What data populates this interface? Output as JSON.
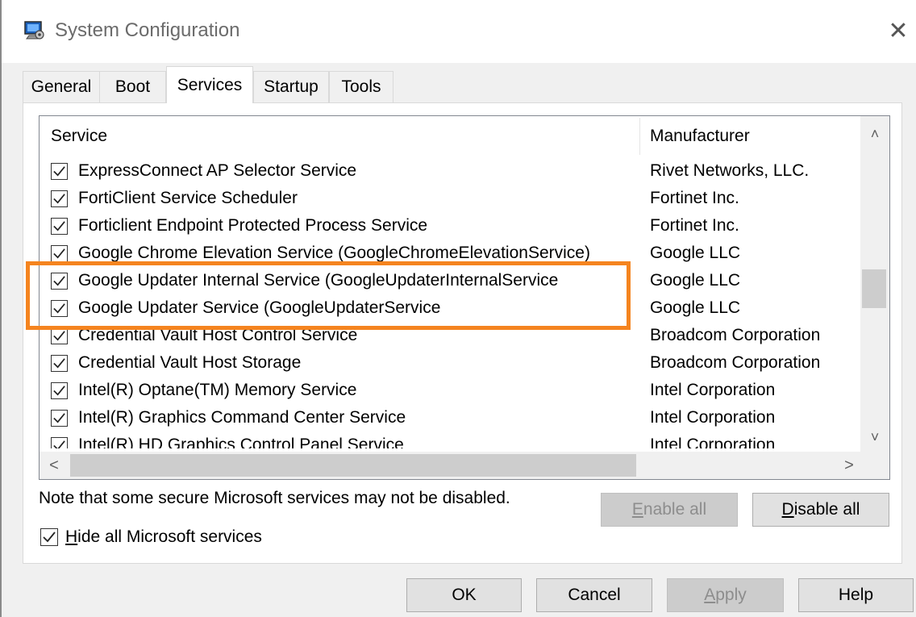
{
  "window": {
    "title": "System Configuration",
    "close_glyph": "✕"
  },
  "tabs": [
    {
      "label": "General",
      "active": false
    },
    {
      "label": "Boot",
      "active": false
    },
    {
      "label": "Services",
      "active": true
    },
    {
      "label": "Startup",
      "active": false
    },
    {
      "label": "Tools",
      "active": false
    }
  ],
  "services_list": {
    "columns": [
      "Service",
      "Manufacturer"
    ],
    "rows": [
      {
        "service": "ExpressConnect AP Selector Service",
        "manufacturer": "Rivet Networks, LLC.",
        "checked": true
      },
      {
        "service": "FortiClient Service Scheduler",
        "manufacturer": "Fortinet Inc.",
        "checked": true
      },
      {
        "service": "Forticlient Endpoint Protected Process Service",
        "manufacturer": "Fortinet Inc.",
        "checked": true
      },
      {
        "service": "Google Chrome Elevation Service (GoogleChromeElevationService)",
        "manufacturer": "Google LLC",
        "checked": true
      },
      {
        "service": "Google Updater Internal Service (GoogleUpdaterInternalService",
        "manufacturer": "Google LLC",
        "checked": true
      },
      {
        "service": "Google Updater Service (GoogleUpdaterService",
        "manufacturer": "Google LLC",
        "checked": true
      },
      {
        "service": "Credential Vault Host Control Service",
        "manufacturer": "Broadcom Corporation",
        "checked": true
      },
      {
        "service": "Credential Vault Host Storage",
        "manufacturer": "Broadcom Corporation",
        "checked": true
      },
      {
        "service": "Intel(R) Optane(TM) Memory Service",
        "manufacturer": "Intel Corporation",
        "checked": true
      },
      {
        "service": "Intel(R) Graphics Command Center Service",
        "manufacturer": "Intel Corporation",
        "checked": true
      },
      {
        "service": "Intel(R) HD Graphics Control Panel Service",
        "manufacturer": "Intel Corporation",
        "checked": true
      }
    ],
    "scroll_up_glyph": "˄",
    "scroll_down_glyph": "˅",
    "scroll_left_glyph": "<",
    "scroll_right_glyph": ">"
  },
  "note": "Note that some secure Microsoft services may not be disabled.",
  "buttons": {
    "enable_all": {
      "pre": "",
      "accel": "E",
      "post": "nable all"
    },
    "disable_all": {
      "pre": "",
      "accel": "D",
      "post": "isable all"
    },
    "ok": "OK",
    "cancel": "Cancel",
    "apply": {
      "pre": "",
      "accel": "A",
      "post": "pply"
    },
    "help": "Help"
  },
  "hide_ms": {
    "checked": true,
    "accel": "H",
    "post": "ide all Microsoft services"
  },
  "colors": {
    "highlight": "#f5841f",
    "window_bg": "#f0f0f0"
  },
  "icons": {
    "app": "system-configuration-icon",
    "check": "check-icon"
  }
}
